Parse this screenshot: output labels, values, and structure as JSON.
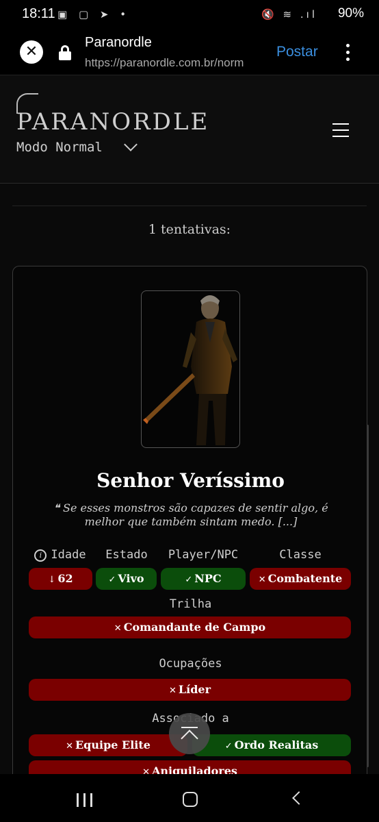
{
  "status_bar": {
    "time": "18:11",
    "battery": "90%",
    "left_icons": "▣ ▢ ➤ •",
    "right_icons": "🔇 ≋ .ıl"
  },
  "browser": {
    "title": "Paranordle",
    "url": "https://paranordle.com.br/norm",
    "action": "Postar",
    "close_glyph": "✕"
  },
  "site": {
    "logo": "PARANORDLE",
    "mode": "Modo Normal",
    "attempts": "1 tentativas:"
  },
  "card": {
    "name": "Senhor Veríssimo",
    "quote": "❝ Se esses monstros são capazes de sentir algo, é melhor que também sintam medo. [...]",
    "headers": {
      "idade": "Idade",
      "estado": "Estado",
      "tipo": "Player/NPC",
      "classe": "Classe",
      "trilha": "Trilha",
      "ocupacoes": "Ocupações",
      "associado": "Associado a"
    },
    "values": {
      "idade": {
        "mark": "↓",
        "text": "62",
        "status": "wrong"
      },
      "estado": {
        "mark": "✓",
        "text": "Vivo",
        "status": "correct"
      },
      "tipo": {
        "mark": "✓",
        "text": "NPC",
        "status": "correct"
      },
      "classe": {
        "mark": "✕",
        "text": "Combatente",
        "status": "wrong"
      },
      "trilha": {
        "mark": "✕",
        "text": "Comandante de Campo",
        "status": "wrong"
      },
      "ocupacoes": [
        {
          "mark": "✕",
          "text": "Líder",
          "status": "wrong"
        }
      ],
      "associado": [
        {
          "mark": "✕",
          "text": "Equipe Elite",
          "status": "wrong"
        },
        {
          "mark": "✓",
          "text": "Ordo Realitas",
          "status": "correct"
        },
        {
          "mark": "✕",
          "text": "Aniquiladores",
          "status": "wrong"
        }
      ]
    }
  },
  "colors": {
    "wrong": "#7a0000",
    "correct": "#0b4d0b",
    "link": "#3b8fe0"
  }
}
